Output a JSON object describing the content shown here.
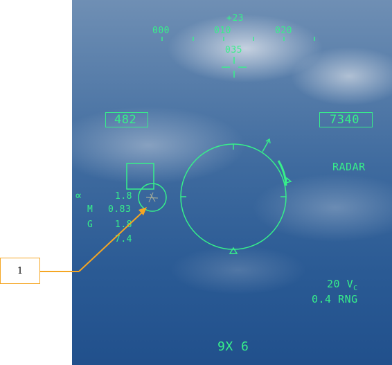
{
  "callout": {
    "label": "1"
  },
  "hud": {
    "pitch_offset": "+23",
    "heading_scale": [
      "000",
      "010",
      "020"
    ],
    "heading_bug": "035",
    "airspeed": "482",
    "altitude": "7340",
    "mode": "RADAR",
    "alpha_symbol": "∝",
    "alpha_value": "1.8",
    "mach_label": "M",
    "mach_value": "0.83",
    "g_label": "G",
    "g_value": "1.8",
    "peak_g": "7.4",
    "closure_value": "20 V",
    "closure_subscript": "C",
    "range": "0.4 RNG",
    "weapon": "9X 6"
  },
  "colors": {
    "hud_symbology": "#37f08a",
    "callout": "#f5a623"
  }
}
